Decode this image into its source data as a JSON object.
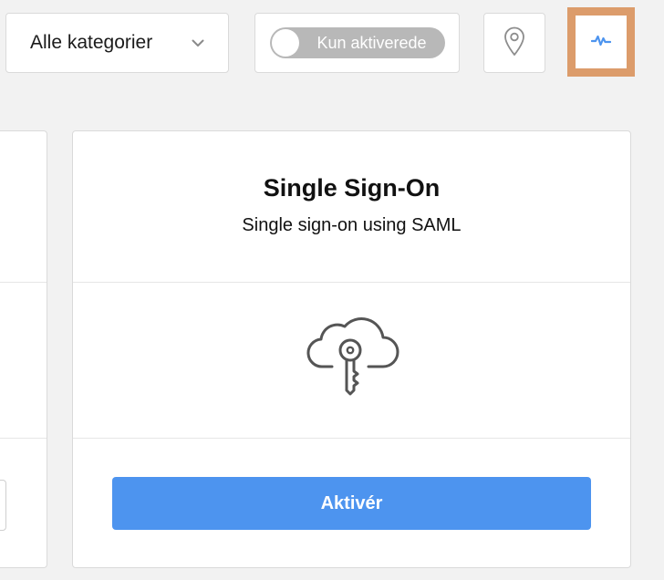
{
  "filters": {
    "category_select": {
      "value": "Alle kategorier",
      "icon": "chevron-down-icon"
    },
    "active_only_toggle": {
      "label": "Kun aktiverede",
      "checked": false
    },
    "location_button": {
      "icon": "map-pin-icon"
    },
    "activity_button": {
      "icon": "activity-icon",
      "highlighted": true
    }
  },
  "card": {
    "title": "Single Sign-On",
    "subtitle": "Single sign-on using SAML",
    "icon": "cloud-key-icon",
    "activate_label": "Aktivér"
  },
  "colors": {
    "background": "#f2f2f2",
    "accent": "#4d94ef",
    "highlight_border": "#dc9c6b",
    "toggle_off": "#b8b8b8",
    "icon_gray": "#555555"
  }
}
